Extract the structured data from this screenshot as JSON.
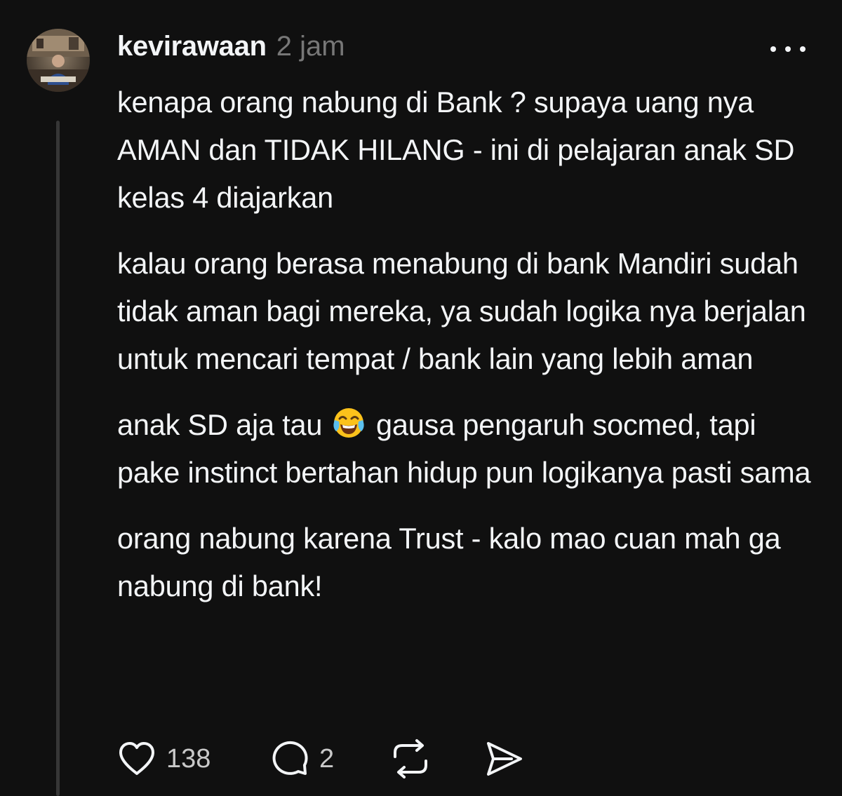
{
  "post": {
    "username": "kevirawaan",
    "time": "2 jam",
    "paragraphs": [
      "kenapa orang nabung di Bank ? supaya uang nya AMAN dan TIDAK HILANG - ini di pelajaran anak SD kelas 4 diajarkan",
      "kalau orang berasa menabung di bank Mandiri sudah tidak aman bagi mereka, ya sudah logika nya berjalan untuk mencari tempat / bank lain yang lebih aman"
    ],
    "para3_before": "anak SD aja tau",
    "para3_after": "gausa pengaruh socmed, tapi pake instinct bertahan hidup pun logikanya pasti sama",
    "para4": "orang nabung karena Trust - kalo mao cuan mah ga nabung di bank!",
    "emoji": "face-with-tears-of-joy"
  },
  "actions": {
    "like_count": "138",
    "reply_count": "2",
    "icons": [
      "heart-icon",
      "comment-icon",
      "repost-icon",
      "share-icon"
    ]
  },
  "colors": {
    "background": "#101010",
    "text": "#f3f5f7",
    "muted": "#777777",
    "thread_line": "#363636"
  }
}
